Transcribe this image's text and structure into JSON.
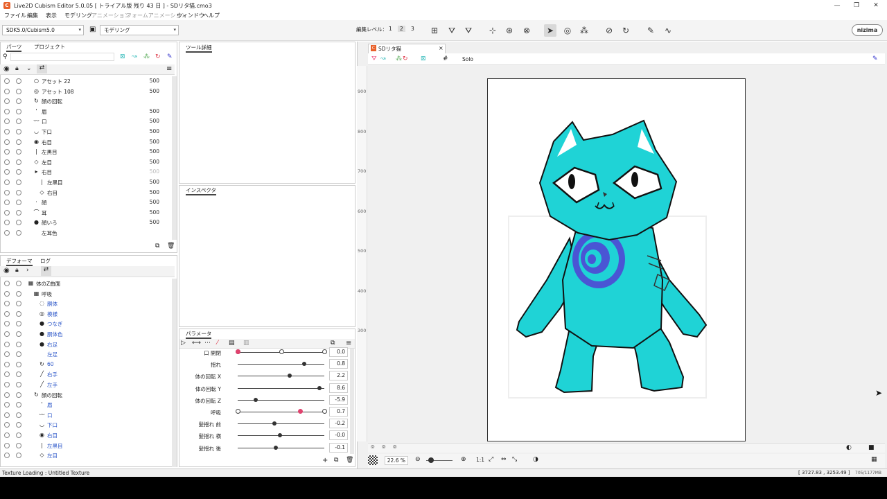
{
  "app": {
    "logo": "C",
    "title": "Live2D Cubism Editor 5.0.05   [ トライアル版 残り 43 日 ]  - SDリタ猫.cmo3"
  },
  "menu": [
    "ファイル",
    "編集",
    "表示",
    "モデリング",
    "アニメーション",
    "フォームアニメーション",
    "ウィンドウ",
    "ヘルプ"
  ],
  "toolbar": {
    "sdk_select": "SDK5.0/Cubism5.0",
    "mode_select": "モデリング",
    "edit_level_label": "編集レベル：",
    "levels": [
      "1",
      "2",
      "3"
    ],
    "brand": "nizima"
  },
  "parts_panel": {
    "tabs": [
      "パーツ",
      "プロジェクト"
    ],
    "rows": [
      {
        "name": "アセット 22",
        "val": "500",
        "indent": 0,
        "icon": "○"
      },
      {
        "name": "アセット 108",
        "val": "500",
        "indent": 0,
        "icon": "◎"
      },
      {
        "name": "顔の回転",
        "val": "",
        "indent": 0,
        "icon": "↻"
      },
      {
        "name": "眉",
        "val": "500",
        "indent": 0,
        "icon": "'"
      },
      {
        "name": "口",
        "val": "500",
        "indent": 0,
        "icon": "〰"
      },
      {
        "name": "下口",
        "val": "500",
        "indent": 0,
        "icon": "◡"
      },
      {
        "name": "右目",
        "val": "500",
        "indent": 0,
        "icon": "◉"
      },
      {
        "name": "左黒目",
        "val": "500",
        "indent": 0,
        "icon": "|"
      },
      {
        "name": "左目",
        "val": "500",
        "indent": 0,
        "icon": "◇"
      },
      {
        "name": "右目",
        "val": "500",
        "indent": 0,
        "icon": "▸",
        "dim": true
      },
      {
        "name": "左黒目",
        "val": "500",
        "indent": 1,
        "icon": "|"
      },
      {
        "name": "右目",
        "val": "500",
        "indent": 1,
        "icon": "◇"
      },
      {
        "name": "顔",
        "val": "500",
        "indent": 0,
        "icon": "·"
      },
      {
        "name": "耳",
        "val": "500",
        "indent": 0,
        "icon": "⌒"
      },
      {
        "name": "顔いろ",
        "val": "500",
        "indent": 0,
        "icon": "●"
      },
      {
        "name": "左耳色",
        "val": "",
        "indent": 0,
        "icon": ""
      }
    ]
  },
  "tool_details": {
    "tab": "ツール詳細"
  },
  "inspector": {
    "tab": "インスペクタ"
  },
  "deformer_panel": {
    "tabs": [
      "デフォーマ",
      "ログ"
    ],
    "rows": [
      {
        "name": "体のZ曲面",
        "indent": 0,
        "icon": "▦",
        "blue": false
      },
      {
        "name": "呼吸",
        "indent": 1,
        "icon": "▦",
        "blue": false
      },
      {
        "name": "胴体",
        "indent": 2,
        "icon": "◌",
        "blue": true
      },
      {
        "name": "模様",
        "indent": 2,
        "icon": "◎",
        "blue": true
      },
      {
        "name": "つなぎ",
        "indent": 2,
        "icon": "●",
        "blue": true
      },
      {
        "name": "胴体色",
        "indent": 2,
        "icon": "●",
        "blue": true
      },
      {
        "name": "右足",
        "indent": 2,
        "icon": "●",
        "blue": true
      },
      {
        "name": "左足",
        "indent": 2,
        "icon": "",
        "blue": true
      },
      {
        "name": "60",
        "indent": 2,
        "icon": "↻",
        "blue": true
      },
      {
        "name": "右手",
        "indent": 2,
        "icon": "╱",
        "blue": true
      },
      {
        "name": "左手",
        "indent": 2,
        "icon": "╱",
        "blue": true
      },
      {
        "name": "顔の回転",
        "indent": 1,
        "icon": "↻",
        "blue": false
      },
      {
        "name": "眉",
        "indent": 2,
        "icon": "'",
        "blue": true
      },
      {
        "name": "口",
        "indent": 2,
        "icon": "〰",
        "blue": true
      },
      {
        "name": "下口",
        "indent": 2,
        "icon": "◡",
        "blue": true
      },
      {
        "name": "右目",
        "indent": 2,
        "icon": "◉",
        "blue": true
      },
      {
        "name": "左黒目",
        "indent": 2,
        "icon": "|",
        "blue": true
      },
      {
        "name": "左目",
        "indent": 2,
        "icon": "◇",
        "blue": true
      }
    ]
  },
  "param_panel": {
    "tab": "パラメータ",
    "rows": [
      {
        "name": "口 開閉",
        "value": "0.0",
        "pos": 0.0,
        "red": true,
        "endcaps": true,
        "mid": 0.5
      },
      {
        "name": "揺れ",
        "value": "0.8",
        "pos": 0.77,
        "red": false,
        "endcaps": false
      },
      {
        "name": "体の回転 X",
        "value": "2.2",
        "pos": 0.6,
        "red": false,
        "endcaps": false
      },
      {
        "name": "体の回転 Y",
        "value": "8.6",
        "pos": 0.94,
        "red": false,
        "endcaps": false
      },
      {
        "name": "体の回転 Z",
        "value": "-5.9",
        "pos": 0.21,
        "red": false,
        "endcaps": false
      },
      {
        "name": "呼吸",
        "value": "0.7",
        "pos": 0.72,
        "red": true,
        "endcaps": true
      },
      {
        "name": "髪揺れ 前",
        "value": "-0.2",
        "pos": 0.42,
        "red": false,
        "endcaps": false
      },
      {
        "name": "髪揺れ 横",
        "value": "-0.0",
        "pos": 0.49,
        "red": false,
        "endcaps": false
      },
      {
        "name": "髪揺れ 後",
        "value": "-0.1",
        "pos": 0.44,
        "red": false,
        "endcaps": false
      }
    ]
  },
  "viewer": {
    "tab": "SDリタ猫",
    "solo": "Solo",
    "ruler": [
      "900",
      "800",
      "700",
      "600",
      "500",
      "400",
      "300"
    ],
    "zoom": "22.6 %",
    "ratio": "1:1"
  },
  "status": {
    "left": "Texture Loading : Untitled Texture",
    "coords": "[ 3727.83 , 3253.49 ]",
    "mem": "705/1177MB"
  },
  "colors": {
    "cat": "#1fd3d6",
    "spiral": "#4a55d4",
    "accent": "#e0426e"
  }
}
